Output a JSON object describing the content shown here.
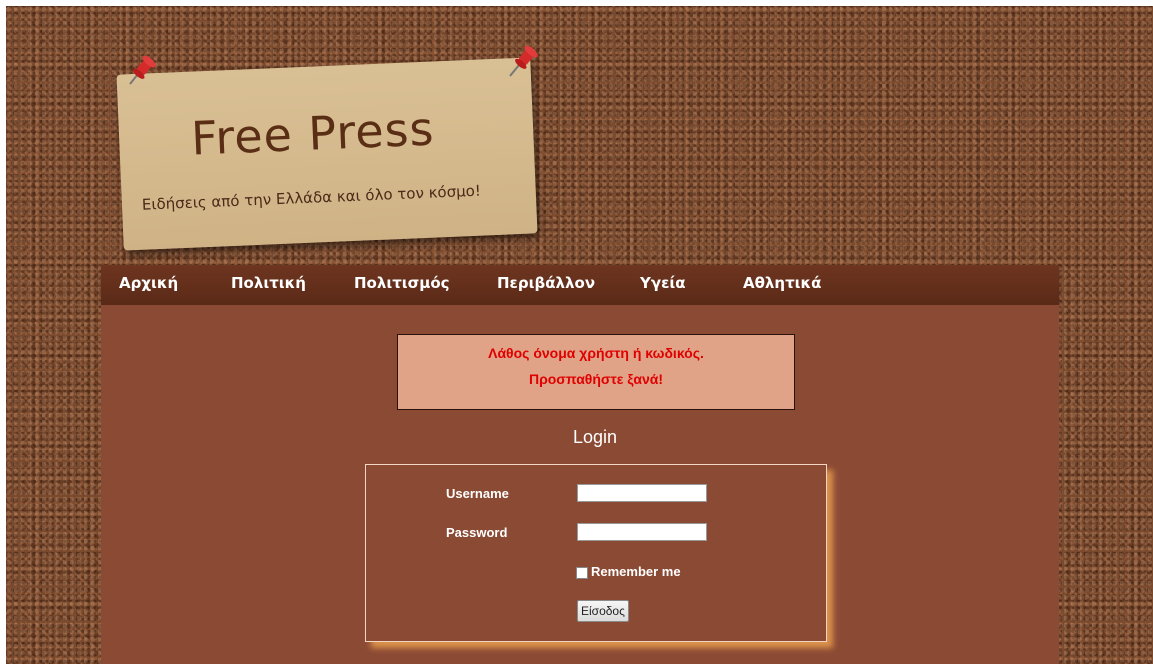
{
  "header": {
    "title": "Free Press",
    "subtitle": "Ειδήσεις από την Ελλάδα και όλο τον κόσμο!",
    "pin_icon": "pushpin-icon",
    "pin_color": "#d42a2a"
  },
  "nav": {
    "items": [
      {
        "label": "Αρχική"
      },
      {
        "label": "Πολιτική"
      },
      {
        "label": "Πολιτισμός"
      },
      {
        "label": "Περιβάλλον"
      },
      {
        "label": "Υγεία"
      },
      {
        "label": "Αθλητικά"
      }
    ]
  },
  "error": {
    "line1": "Λάθος όνομα χρήστη ή κωδικός.",
    "line2": "Προσπαθήστε ξανά!",
    "color": "#e00000"
  },
  "login": {
    "title": "Login",
    "username_label": "Username",
    "username_value": "",
    "password_label": "Password",
    "password_value": "",
    "remember_label": "Remember me",
    "submit_label": "Είσοδος"
  }
}
